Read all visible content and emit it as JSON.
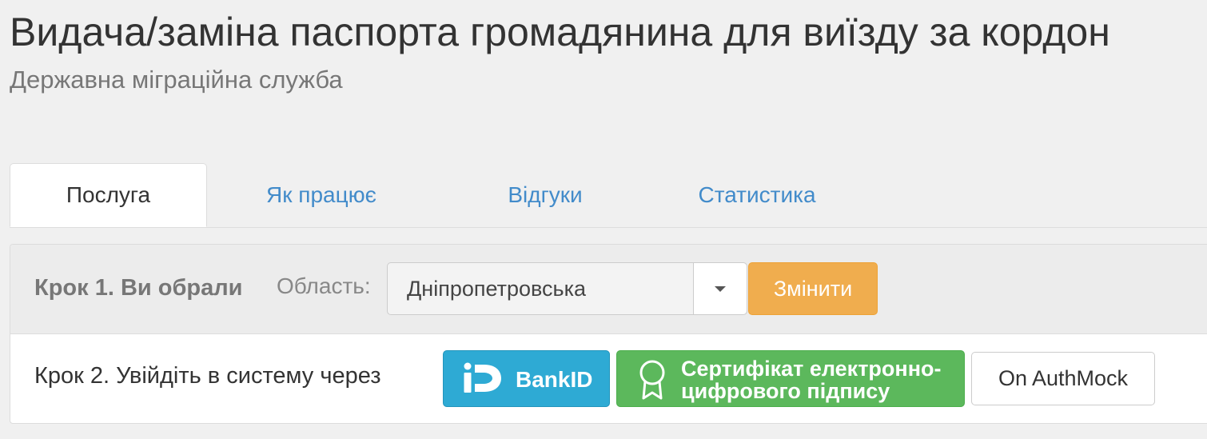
{
  "header": {
    "title": "Видача/заміна паспорта громадянина для виїзду за кордон",
    "subtitle": "Державна міграційна служба"
  },
  "tabs": [
    {
      "label": "Послуга",
      "active": true
    },
    {
      "label": "Як працює",
      "active": false
    },
    {
      "label": "Відгуки",
      "active": false
    },
    {
      "label": "Статистика",
      "active": false
    }
  ],
  "step1": {
    "label": "Крок 1. Ви обрали",
    "region_label": "Область:",
    "region_value": "Дніпропетровська",
    "change_button": "Змінити"
  },
  "step2": {
    "label": "Крок 2. Увійдіть в систему через",
    "bankid_button": "BankID",
    "cert_button_line1": "Сертифікат електронно-",
    "cert_button_line2": "цифрового підпису",
    "mock_button": "On AuthMock"
  },
  "colors": {
    "background": "#f0f0f0",
    "link": "#428bca",
    "warning": "#f0ad4e",
    "bankid": "#2eaad4",
    "success": "#5cb85c"
  },
  "icons": {
    "bankid_logo": "bankid-logo-icon",
    "certificate": "award-ribbon-icon",
    "dropdown": "caret-down-icon"
  }
}
